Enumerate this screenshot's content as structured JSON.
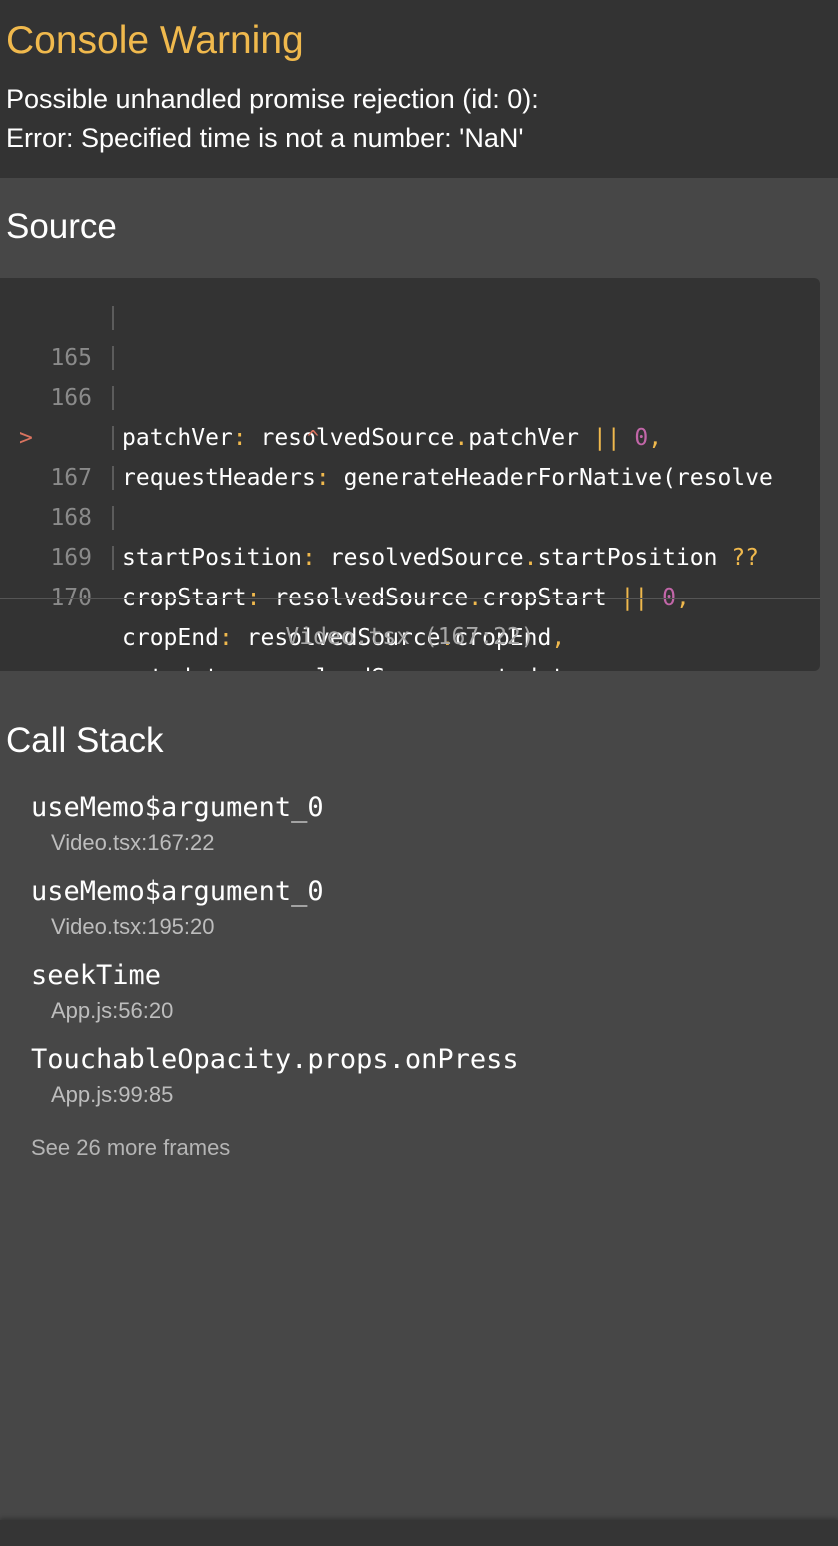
{
  "header": {
    "title": "Console Warning",
    "message_line_1": "Possible unhandled promise rejection (id: 0):",
    "message_line_2": "Error: Specified time is not a number: 'NaN'"
  },
  "source": {
    "title": "Source",
    "lines": [
      {
        "number": "165",
        "key": "patchVer",
        "colon": ":",
        "obj": " resolvedSource",
        "dot": ".",
        "prop": "patchVer",
        "op": " ||",
        "num": " 0",
        "comma": ","
      },
      {
        "number": "166",
        "key": "requestHeaders",
        "colon": ":",
        "rest": " generateHeaderForNative(resolve"
      },
      {
        "number": "167",
        "marker": ">",
        "key": "startPosition",
        "colon": ":",
        "obj": " resolvedSource",
        "dot": ".",
        "prop": "startPosition",
        "op": " ??"
      },
      {
        "caret": "^"
      },
      {
        "number": "168",
        "key": "cropStart",
        "colon": ":",
        "obj": " resolvedSource",
        "dot": ".",
        "prop": "cropStart",
        "op": " ||",
        "num": " 0",
        "comma": ","
      },
      {
        "number": "169",
        "key": "cropEnd",
        "colon": ":",
        "obj": " resolvedSource",
        "dot": ".",
        "prop": "cropEnd",
        "comma": ","
      },
      {
        "number": "170",
        "key": "metadata",
        "colon": ":",
        "obj": " resolvedSource",
        "dot": ".",
        "prop": "metadata",
        "comma": ","
      }
    ],
    "file_label": "Video.tsx (167:22)"
  },
  "call_stack": {
    "title": "Call Stack",
    "frames": [
      {
        "fn": "useMemo$argument_0",
        "location": "Video.tsx:167:22"
      },
      {
        "fn": "useMemo$argument_0",
        "location": "Video.tsx:195:20"
      },
      {
        "fn": "seekTime",
        "location": "App.js:56:20"
      },
      {
        "fn": "TouchableOpacity.props.onPress",
        "location": "App.js:99:85"
      }
    ],
    "more_frames": "See 26 more frames"
  },
  "colors": {
    "accent": "#f0b94d",
    "number": "#c266a8",
    "marker": "#d9735f"
  }
}
